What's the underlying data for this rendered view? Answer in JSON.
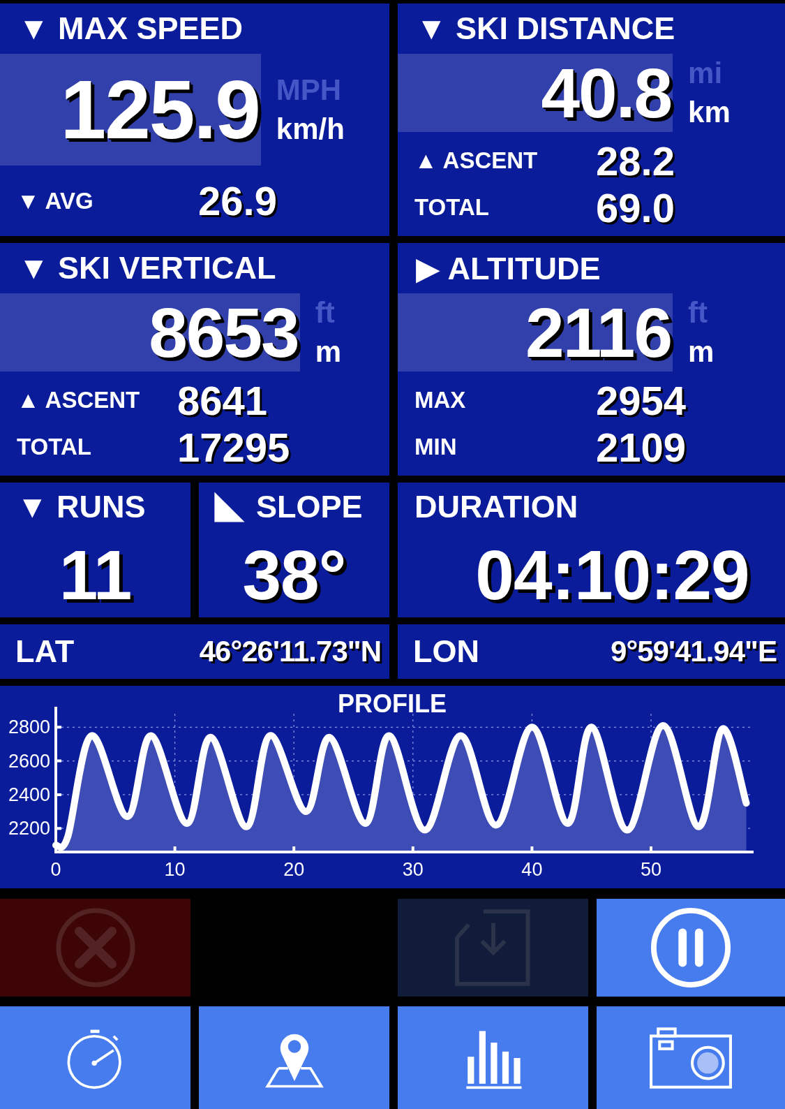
{
  "panels": [
    {
      "marker": "▼",
      "title": "MAX SPEED",
      "value": "125.9",
      "units": [
        {
          "label": "MPH",
          "selected": false
        },
        {
          "label": "km/h",
          "selected": true
        }
      ],
      "stats": [
        {
          "marker": "▼",
          "label": "AVG",
          "value": "26.9"
        }
      ]
    },
    {
      "marker": "▼",
      "title": "SKI DISTANCE",
      "value": "40.8",
      "units": [
        {
          "label": "mi",
          "selected": false
        },
        {
          "label": "km",
          "selected": true
        }
      ],
      "stats": [
        {
          "marker": "▲",
          "label": "ASCENT",
          "value": "28.2"
        },
        {
          "label": "TOTAL",
          "value": "69.0"
        }
      ]
    },
    {
      "marker": "▼",
      "title": "SKI VERTICAL",
      "value": "8653",
      "units": [
        {
          "label": "ft",
          "selected": false
        },
        {
          "label": "m",
          "selected": true
        }
      ],
      "stats": [
        {
          "marker": "▲",
          "label": "ASCENT",
          "value": "8641"
        },
        {
          "label": "TOTAL",
          "value": "17295"
        }
      ]
    },
    {
      "marker": "▶",
      "title": "ALTITUDE",
      "value": "2116",
      "units": [
        {
          "label": "ft",
          "selected": false
        },
        {
          "label": "m",
          "selected": true
        }
      ],
      "stats": [
        {
          "label": "MAX",
          "value": "2954"
        },
        {
          "label": "MIN",
          "value": "2109"
        }
      ]
    }
  ],
  "tiles": [
    {
      "kind": "marker",
      "marker": "▼",
      "title": "RUNS",
      "value": "11"
    },
    {
      "kind": "slope",
      "title": "SLOPE",
      "value": "38°"
    },
    {
      "kind": "plain",
      "title": "DURATION",
      "value": "04:10:29"
    }
  ],
  "coordinates": [
    {
      "label": "LAT",
      "value": "46°26'11.73\"N"
    },
    {
      "label": "LON",
      "value": "9°59'41.94\"E"
    }
  ],
  "profile": {
    "chart_data": {
      "type": "area",
      "title": "PROFILE",
      "x": [
        0,
        1,
        3,
        6,
        8,
        11,
        13,
        16,
        18,
        21,
        23,
        26,
        28,
        31,
        34,
        37,
        40,
        43,
        45,
        48,
        51,
        54,
        56,
        58
      ],
      "grid": true,
      "series": [
        {
          "color": "#ffffff",
          "values": [
            2100,
            2150,
            2750,
            2270,
            2750,
            2230,
            2740,
            2210,
            2750,
            2300,
            2740,
            2230,
            2750,
            2190,
            2750,
            2220,
            2800,
            2230,
            2800,
            2190,
            2810,
            2210,
            2790,
            2350
          ]
        }
      ],
      "xlim": [
        0,
        58.5
      ],
      "ylim": [
        2060,
        2880
      ],
      "xticks": [
        0,
        10,
        20,
        30,
        40,
        50
      ],
      "yticks": [
        2200,
        2400,
        2600,
        2800
      ]
    }
  },
  "controls": [
    {
      "kind": "cancel",
      "disabled": true
    },
    {
      "kind": "empty"
    },
    {
      "kind": "save",
      "disabled": true
    },
    {
      "kind": "pause",
      "disabled": false
    }
  ],
  "nav": [
    {
      "kind": "stopwatch"
    },
    {
      "kind": "map"
    },
    {
      "kind": "stats"
    },
    {
      "kind": "camera"
    }
  ]
}
